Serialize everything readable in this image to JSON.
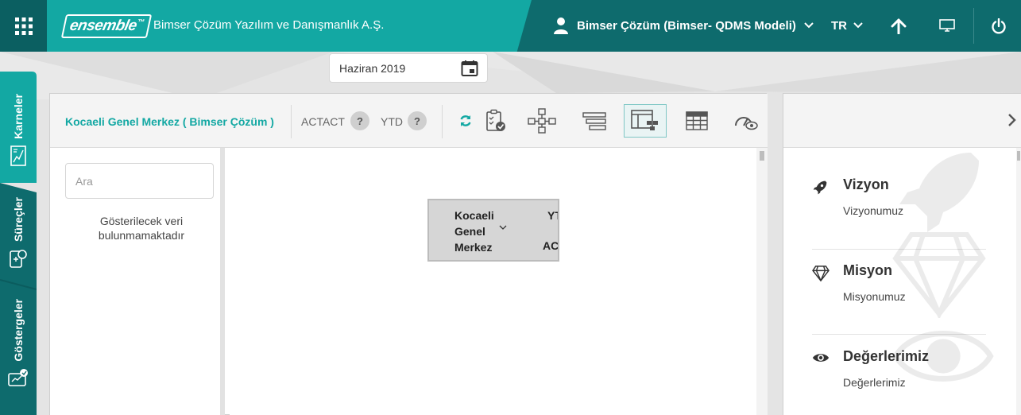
{
  "header": {
    "logo_text": "ensemble",
    "logo_tm": "™",
    "company_name": "Bimser Çözüm Yazılım ve Danışmanlık A.Ş.",
    "user_name": "Bimser Çözüm (Bimser- QDMS Modeli)",
    "language": "TR",
    "icons": [
      "apps-grid-icon",
      "user-icon",
      "chevron-down-icon",
      "arrow-up-icon",
      "monitor-icon",
      "power-icon"
    ]
  },
  "side_tabs": [
    {
      "label": "Karneler",
      "icon": "scorecard-icon"
    },
    {
      "label": "Süreçler",
      "icon": "process-icon"
    },
    {
      "label": "Göstergeler",
      "icon": "indicator-icon"
    }
  ],
  "date_picker": {
    "value": "Haziran 2019",
    "icon": "calendar-icon"
  },
  "toolbar": {
    "org_title": "Kocaeli Genel Merkez ( Bimser Çözüm )",
    "actact_label": "ACTACT",
    "ytd_label": "YTD",
    "help_glyph": "?",
    "view_buttons": [
      "refresh-icon",
      "clipboard-check-icon",
      "org-tree-icon",
      "list-view-icon",
      "org-table-view-icon",
      "table-icon",
      "gauge-eye-icon"
    ]
  },
  "left_pane": {
    "search_placeholder": "Ara",
    "no_data": "Gösterilecek veri bulunmamaktadır"
  },
  "org_node": {
    "name_lines": [
      "Kocaeli",
      "Genel",
      "Merkez"
    ],
    "ytd": "YTD",
    "act": "ACT"
  },
  "right_panel": {
    "sections": [
      {
        "title": "Vizyon",
        "text": "Vizyonumuz",
        "icon": "rocket-icon"
      },
      {
        "title": "Misyon",
        "text": "Misyonumuz",
        "icon": "diamond-icon"
      },
      {
        "title": "Değerlerimiz",
        "text": "Değerlerimiz",
        "icon": "eye-icon"
      }
    ]
  },
  "colors": {
    "header_dark": "#0e6b6d",
    "brand_teal": "#13a8a3",
    "sidetab_active": "#13a8a3",
    "sidetab_dark": "#0e6b6d"
  }
}
